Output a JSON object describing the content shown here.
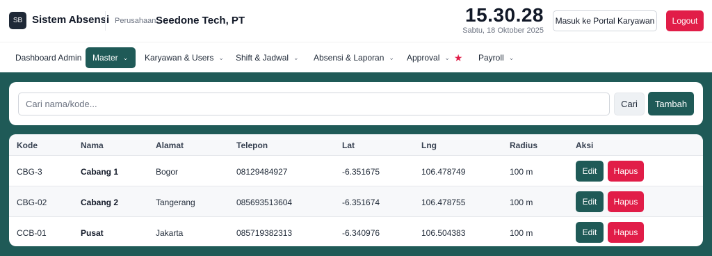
{
  "header": {
    "logo_text": "SB",
    "app_title": "Sistem Absensi",
    "company_label": "Perusahaan:",
    "company_name": "Seedone Tech, PT",
    "clock": "15.30.28",
    "date": "Sabtu, 18 Oktober 2025",
    "portal_label": "Masuk ke Portal Karyawan",
    "logout_label": "Logout"
  },
  "nav": {
    "items": [
      {
        "label": "Dashboard Admin"
      },
      {
        "label": "Master"
      },
      {
        "label": "Karyawan & Users"
      },
      {
        "label": "Shift & Jadwal"
      },
      {
        "label": "Absensi & Laporan"
      },
      {
        "label": "Approval"
      },
      {
        "label": "Payroll"
      }
    ],
    "active": "Master"
  },
  "search": {
    "placeholder": "Cari nama/kode...",
    "search_label": "Cari",
    "add_label": "Tambah"
  },
  "table": {
    "headers": [
      "Kode",
      "Nama",
      "Alamat",
      "Telepon",
      "Lat",
      "Lng",
      "Radius",
      "Aksi"
    ],
    "rows": [
      {
        "kode": "CBG-3",
        "nama": "Cabang 1",
        "alamat": "Bogor",
        "telepon": "08129484927",
        "lat": "-6.351675",
        "lng": "106.478749",
        "radius": "100 m"
      },
      {
        "kode": "CBG-02",
        "nama": "Cabang 2",
        "alamat": "Tangerang",
        "telepon": "085693513604",
        "lat": "-6.351674",
        "lng": "106.478755",
        "radius": "100 m"
      },
      {
        "kode": "CCB-01",
        "nama": "Pusat",
        "alamat": "Jakarta",
        "telepon": "085719382313",
        "lat": "-6.340976",
        "lng": "106.504383",
        "radius": "100 m"
      }
    ],
    "edit_label": "Edit",
    "delete_label": "Hapus"
  },
  "colors": {
    "primary": "#1f5a57",
    "danger": "#e11d48",
    "star": "#e11d48"
  },
  "icons": {
    "dropdown": "chevron-down-icon",
    "approval_badge": "star-icon"
  }
}
